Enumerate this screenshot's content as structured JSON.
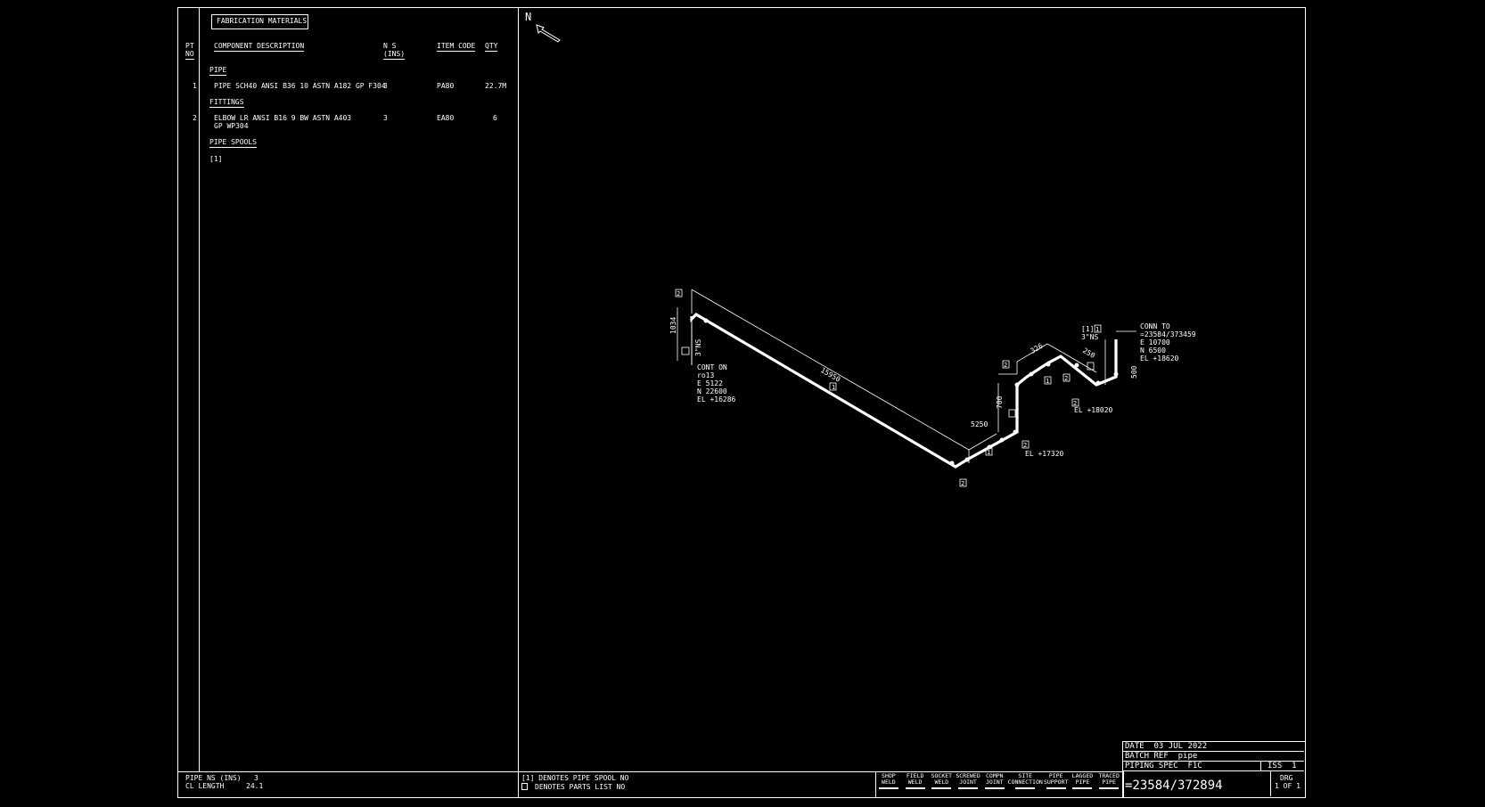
{
  "header": {
    "title": "FABRICATION MATERIALS"
  },
  "columns": {
    "pt": "PT",
    "pt2": "NO",
    "desc": "COMPONENT DESCRIPTION",
    "ns": "N S",
    "ns2": "(INS)",
    "item": "ITEM CODE",
    "qty": "QTY"
  },
  "sections": {
    "pipe": "PIPE",
    "fittings": "FITTINGS",
    "spools": "PIPE SPOOLS",
    "spool_ref": "[1]"
  },
  "rows": [
    {
      "pt": "1",
      "desc": "PIPE SCH40 ANSI B36 10 ASTN A182 GP F304",
      "desc2": "",
      "ns": "3",
      "item": "PA80",
      "qty": "22.7M"
    },
    {
      "pt": "2",
      "desc": "ELBOW LR ANSI B16 9 BW ASTN A403",
      "desc2": "GP WP304",
      "ns": "3",
      "item": "EA80",
      "qty": "6"
    }
  ],
  "north": "N",
  "iso": {
    "cont_on": [
      "CONT ON",
      "ro13",
      "E 5122",
      "N 22600",
      "EL +16286"
    ],
    "conn_to": [
      "CONN TO",
      "=23584/373459",
      "E 10700",
      "N 6500",
      "EL +18620"
    ],
    "size_a": "3\"NS",
    "size_b": "3\"NS",
    "spool_tag": "[1]",
    "dim_1034": "1034",
    "dim_15950": "15950",
    "dim_5250": "5250",
    "dim_700": "700",
    "dim_326": "326",
    "dim_250": "250",
    "dim_500": "500",
    "el_17320": "EL +17320",
    "el_18020": "EL +18020",
    "tag_1": "1",
    "tag_2": "2"
  },
  "footer": {
    "pipe_ns_label": "PIPE NS (INS)",
    "pipe_ns_val": "3",
    "cl_label": "CL LENGTH",
    "cl_val": "24.1",
    "note1": "[1] DENOTES PIPE SPOOL NO",
    "note2": "DENOTES PARTS LIST NO"
  },
  "legend": [
    {
      "l1": "SHOP",
      "l2": "WELD"
    },
    {
      "l1": "FIELD",
      "l2": "WELD"
    },
    {
      "l1": "SOCKET",
      "l2": "WELD"
    },
    {
      "l1": "SCREWED",
      "l2": "JOINT"
    },
    {
      "l1": "COMPN",
      "l2": "JOINT"
    },
    {
      "l1": "SITE",
      "l2": "CONNECTION"
    },
    {
      "l1": "PIPE",
      "l2": "SUPPORT"
    },
    {
      "l1": "LAGGED",
      "l2": "PIPE"
    },
    {
      "l1": "TRACED",
      "l2": "PIPE"
    }
  ],
  "title_block": {
    "date": "DATE  03 JUL 2022",
    "batch": "BATCH REF  pipe",
    "spec": "PIPING SPEC  F1C",
    "iss": "ISS  1",
    "drawing_no": "=23584/372894",
    "drg": "DRG",
    "sheet": "1 OF 1"
  }
}
